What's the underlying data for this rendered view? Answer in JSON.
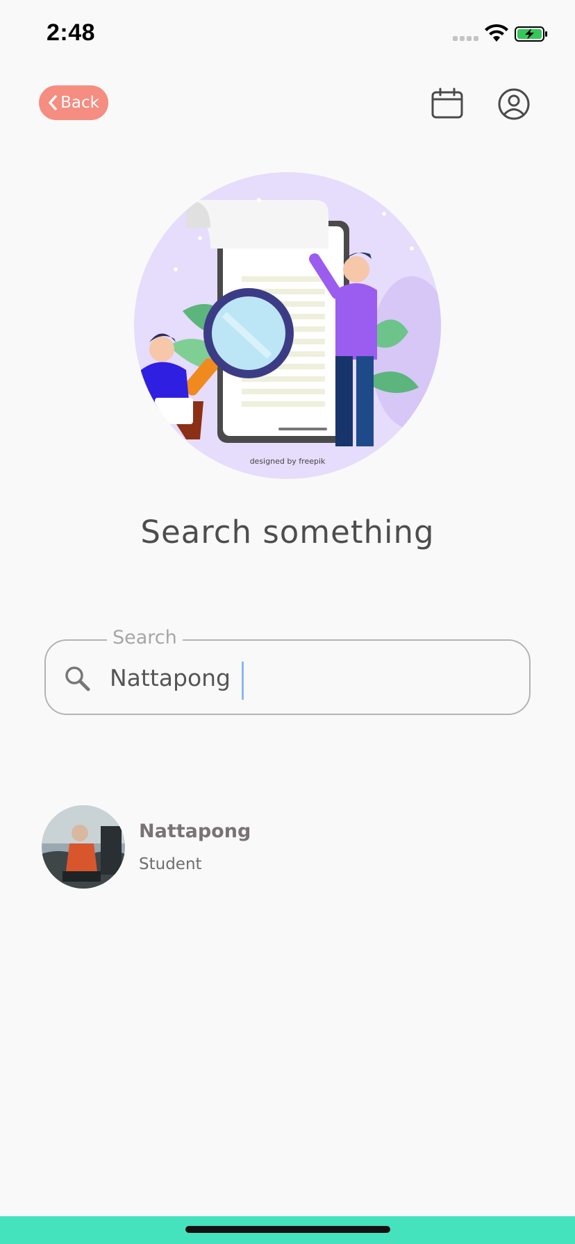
{
  "status_bar": {
    "time": "2:48"
  },
  "header": {
    "back_label": "Back"
  },
  "illustration": {
    "credit": "designed by freepik"
  },
  "title": "Search something",
  "search": {
    "label": "Search",
    "value": "Nattapong"
  },
  "results": [
    {
      "name": "Nattapong",
      "role": "Student"
    }
  ],
  "colors": {
    "accent": "#f58d80",
    "bottom_bar": "#44e2bd",
    "text_dark": "#4d4d4d"
  }
}
